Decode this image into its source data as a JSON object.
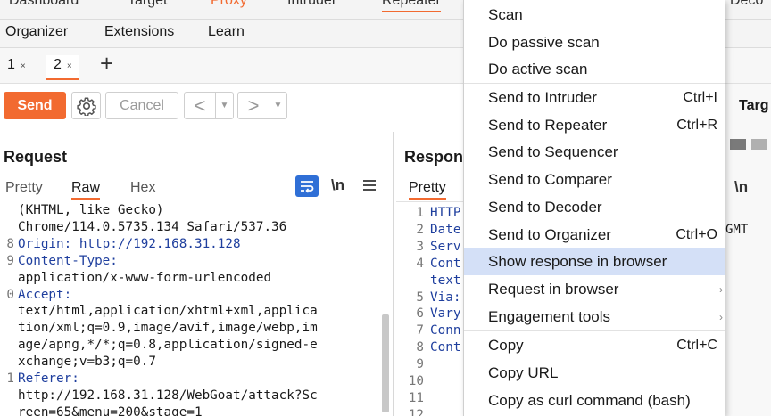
{
  "top_tabs": [
    "Dashboard",
    "Target",
    "Proxy",
    "Intruder",
    "Repeater",
    "Deco"
  ],
  "second_tabs": [
    "Organizer",
    "Extensions",
    "Learn"
  ],
  "repeater_tabs": [
    {
      "label": "1",
      "close": "×"
    },
    {
      "label": "2",
      "close": "×"
    }
  ],
  "add_tab": "+",
  "toolbar": {
    "send": "Send",
    "cancel": "Cancel",
    "back": "<",
    "forward": ">",
    "drop": "▼"
  },
  "request": {
    "title": "Request",
    "tabs": [
      "Pretty",
      "Raw",
      "Hex"
    ],
    "newline_toggle": "\\n",
    "lines": [
      {
        "n": "",
        "text": "(KHTML, like Gecko)",
        "blue": false
      },
      {
        "n": "",
        "text": "Chrome/114.0.5735.134 Safari/537.36",
        "blue": false
      },
      {
        "n": "8",
        "text": "Origin: http://192.168.31.128",
        "blue": true
      },
      {
        "n": "9",
        "text": "Content-Type:",
        "blue": true
      },
      {
        "n": "",
        "text": "application/x-www-form-urlencoded",
        "blue": false
      },
      {
        "n": "0",
        "text": "Accept:",
        "blue": true
      },
      {
        "n": "",
        "text": "text/html,application/xhtml+xml,applica",
        "blue": false
      },
      {
        "n": "",
        "text": "tion/xml;q=0.9,image/avif,image/webp,im",
        "blue": false
      },
      {
        "n": "",
        "text": "age/apng,*/*;q=0.8,application/signed-e",
        "blue": false
      },
      {
        "n": "",
        "text": "xchange;v=b3;q=0.7",
        "blue": false
      },
      {
        "n": "1",
        "text": "Referer:",
        "blue": true
      },
      {
        "n": "",
        "text": "http://192.168.31.128/WebGoat/attack?Sc",
        "blue": false
      },
      {
        "n": "",
        "text": "reen=65&menu=200&stage=1",
        "blue": false
      }
    ]
  },
  "response": {
    "title": "Respon",
    "tabs": [
      "Pretty"
    ],
    "lines": [
      {
        "n": "1",
        "text": "HTTP"
      },
      {
        "n": "2",
        "text": "Date"
      },
      {
        "n": "3",
        "text": "Serv"
      },
      {
        "n": "4",
        "text": "Cont"
      },
      {
        "n": "",
        "text": "text"
      },
      {
        "n": "5",
        "text": "Via:"
      },
      {
        "n": "6",
        "text": "Vary"
      },
      {
        "n": "7",
        "text": "Conn"
      },
      {
        "n": "8",
        "text": "Cont"
      },
      {
        "n": "9",
        "text": ""
      },
      {
        "n": "10",
        "text": ""
      },
      {
        "n": "11",
        "text": ""
      },
      {
        "n": "12",
        "text": ""
      }
    ]
  },
  "right_fragments": {
    "target": "Targ",
    "newline": "\\n",
    "gmt": "GMT"
  },
  "context_menu": [
    {
      "label": "Scan",
      "shortcut": ""
    },
    {
      "label": "Do passive scan",
      "shortcut": ""
    },
    {
      "label": "Do active scan",
      "shortcut": ""
    },
    {
      "label": "Send to Intruder",
      "shortcut": "Ctrl+I"
    },
    {
      "label": "Send to Repeater",
      "shortcut": "Ctrl+R"
    },
    {
      "label": "Send to Sequencer",
      "shortcut": ""
    },
    {
      "label": "Send to Comparer",
      "shortcut": ""
    },
    {
      "label": "Send to Decoder",
      "shortcut": ""
    },
    {
      "label": "Send to Organizer",
      "shortcut": "Ctrl+O"
    },
    {
      "label": "Show response in browser",
      "shortcut": ""
    },
    {
      "label": "Request in browser",
      "shortcut": ""
    },
    {
      "label": "Engagement tools",
      "shortcut": ""
    },
    {
      "label": "Copy",
      "shortcut": "Ctrl+C"
    },
    {
      "label": "Copy URL",
      "shortcut": ""
    },
    {
      "label": "Copy as curl command (bash)",
      "shortcut": ""
    }
  ],
  "colors": {
    "accent": "#f26a30",
    "highlight": "#d4e0f7",
    "header_blue": "#1f3f9e"
  }
}
